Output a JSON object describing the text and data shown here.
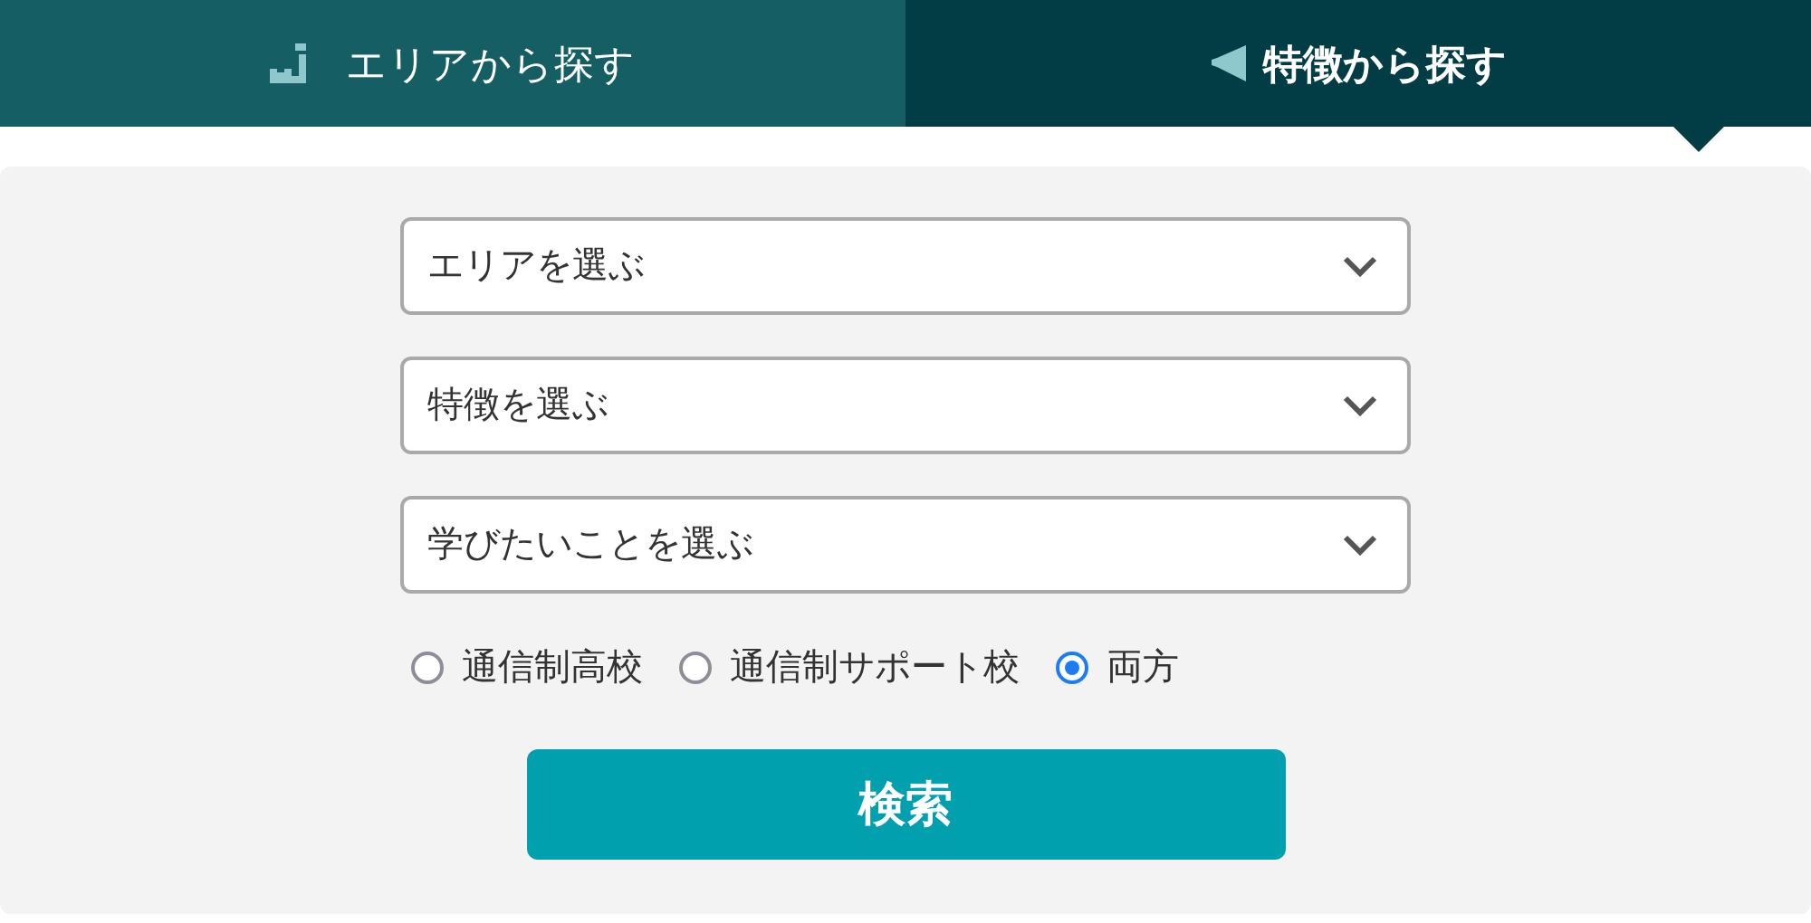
{
  "tabs": [
    {
      "label": "エリアから探す",
      "selected": false
    },
    {
      "label": "特徴から探す",
      "selected": true
    }
  ],
  "selects": [
    {
      "placeholder": "エリアを選ぶ"
    },
    {
      "placeholder": "特徴を選ぶ"
    },
    {
      "placeholder": "学びたいことを選ぶ"
    }
  ],
  "school_type": [
    {
      "label": "通信制高校",
      "selected": false
    },
    {
      "label": "通信制サポート校",
      "selected": false
    },
    {
      "label": "両方",
      "selected": true
    }
  ],
  "search_button": "検索"
}
